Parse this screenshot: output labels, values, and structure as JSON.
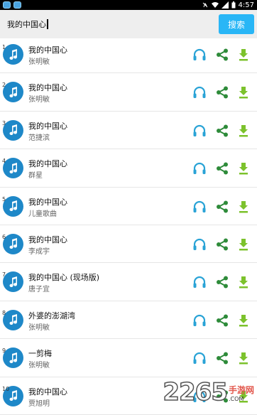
{
  "status_bar": {
    "time": "4:57"
  },
  "search": {
    "query": "我的中国心",
    "button_label": "搜索"
  },
  "results": [
    {
      "num": "1",
      "title": "我的中国心",
      "artist": "张明敏"
    },
    {
      "num": "2",
      "title": "我的中国心",
      "artist": "张明敏"
    },
    {
      "num": "3",
      "title": "我的中国心",
      "artist": "范捷滨"
    },
    {
      "num": "4",
      "title": "我的中国心",
      "artist": "群星"
    },
    {
      "num": "5",
      "title": "我的中国心",
      "artist": "儿童歌曲"
    },
    {
      "num": "6",
      "title": "我的中国心",
      "artist": "李成宇"
    },
    {
      "num": "7",
      "title": "我的中国心 (现场版)",
      "artist": "唐子宜"
    },
    {
      "num": "8",
      "title": "外婆的澎湖湾",
      "artist": "张明敏"
    },
    {
      "num": "9",
      "title": "一剪梅",
      "artist": "张明敏"
    },
    {
      "num": "10",
      "title": "我的中国心",
      "artist": "贾旭明"
    }
  ],
  "icons": {
    "avatar": "music-note-icon",
    "listen": "headphones-icon",
    "share": "share-icon",
    "download": "download-icon"
  },
  "colors": {
    "accent": "#29b6f6",
    "avatar": "#1e88c8",
    "listen": "#29a3d6",
    "share": "#2e8b3a",
    "download": "#7cc22c"
  },
  "watermark": {
    "number": "2265",
    "cn": "手游网",
    "url": ".COM"
  }
}
